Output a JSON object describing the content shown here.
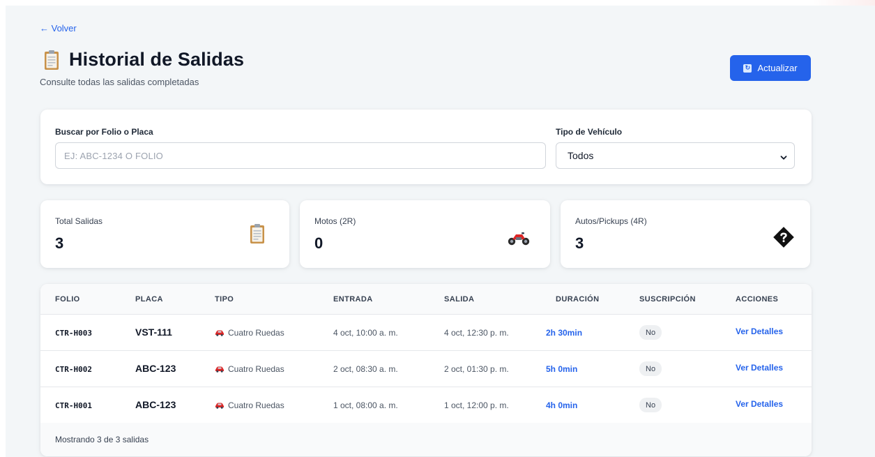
{
  "nav": {
    "back_label": "← Volver"
  },
  "header": {
    "title": "Historial de Salidas",
    "subtitle": "Consulte todas las salidas completadas",
    "refresh_label": "Actualizar"
  },
  "filters": {
    "search_label": "Buscar por Folio o Placa",
    "search_placeholder": "EJ: ABC-1234 O FOLIO",
    "search_value": "",
    "type_label": "Tipo de Vehículo",
    "type_value": "Todos"
  },
  "stats": [
    {
      "label": "Total Salidas",
      "value": "3",
      "icon": "clipboard-icon"
    },
    {
      "label": "Motos (2R)",
      "value": "0",
      "icon": "motorcycle-icon"
    },
    {
      "label": "Autos/Pickups (4R)",
      "value": "3",
      "icon": "unknown-glyph-icon"
    }
  ],
  "table": {
    "columns": [
      "FOLIO",
      "PLACA",
      "TIPO",
      "ENTRADA",
      "SALIDA",
      "DURACIÓN",
      "SUSCRIPCIÓN",
      "ACCIONES"
    ],
    "rows": [
      {
        "folio": "CTR-H003",
        "placa": "VST-111",
        "tipo": "Cuatro Ruedas",
        "entrada": "4 oct, 10:00 a. m.",
        "salida": "4 oct, 12:30 p. m.",
        "duracion": "2h 30min",
        "suscripcion": "No",
        "accion": "Ver Detalles"
      },
      {
        "folio": "CTR-H002",
        "placa": "ABC-123",
        "tipo": "Cuatro Ruedas",
        "entrada": "2 oct, 08:30 a. m.",
        "salida": "2 oct, 01:30 p. m.",
        "duracion": "5h 0min",
        "suscripcion": "No",
        "accion": "Ver Detalles"
      },
      {
        "folio": "CTR-H001",
        "placa": "ABC-123",
        "tipo": "Cuatro Ruedas",
        "entrada": "1 oct, 08:00 a. m.",
        "salida": "1 oct, 12:00 p. m.",
        "duracion": "4h 0min",
        "suscripcion": "No",
        "accion": "Ver Detalles"
      }
    ],
    "footer": "Mostrando 3 de 3 salidas"
  },
  "colors": {
    "accent": "#2563eb",
    "background": "#f3f6f8",
    "car": "#dc2626"
  }
}
